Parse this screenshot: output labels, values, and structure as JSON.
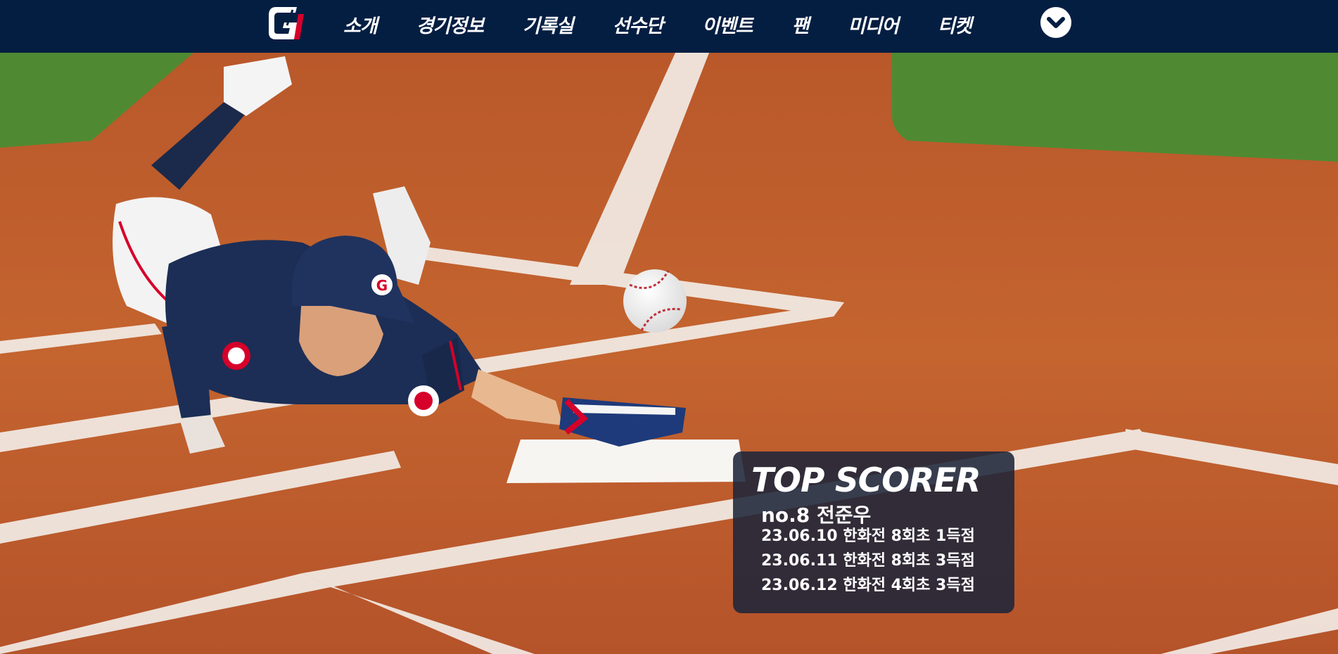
{
  "header": {
    "logo_text": "G1",
    "nav_items": [
      "소개",
      "경기정보",
      "기록실",
      "선수단",
      "이벤트",
      "팬",
      "미디어",
      "티켓"
    ],
    "more_icon": "chevron-down-icon"
  },
  "colors": {
    "nav_background": "#041e42",
    "card_background": "#1e263a",
    "dirt": "#c2622f",
    "grass": "#4f8a32"
  },
  "scorer": {
    "title": "TOP SCORER",
    "player": "no.8 전준우",
    "records": [
      "23.06.10 한화전 8회초 1득점",
      "23.06.11 한화전 8회초 3득점",
      "23.06.12 한화전 4회초 3득점"
    ]
  }
}
